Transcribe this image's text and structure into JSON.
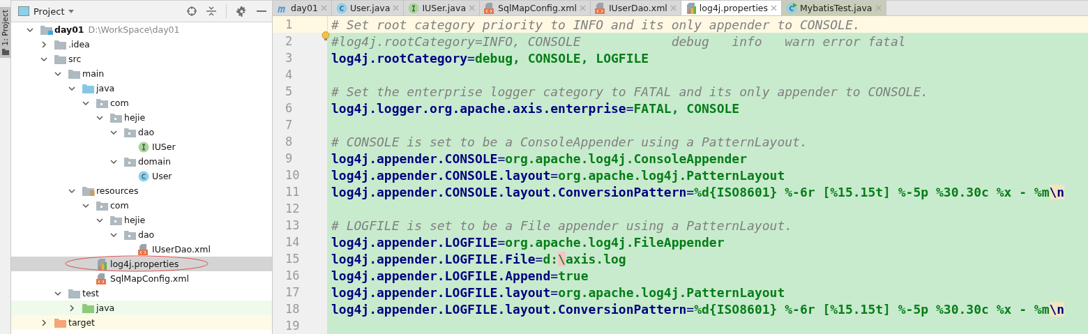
{
  "tool_stripe": {
    "label": "1: Project",
    "selected": true
  },
  "project_panel": {
    "title": "Project",
    "tree": [
      {
        "name": "day01",
        "note": "D:\\WorkSpace\\day01",
        "kind": "module",
        "expanded": true,
        "selected": false,
        "children": [
          {
            "name": ".idea",
            "kind": "folder",
            "expanded": false,
            "selected": false
          },
          {
            "name": "src",
            "kind": "folder",
            "expanded": true,
            "selected": false,
            "children": [
              {
                "name": "main",
                "kind": "folder",
                "expanded": true,
                "selected": false,
                "children": [
                  {
                    "name": "java",
                    "kind": "source-folder",
                    "expanded": true,
                    "selected": false,
                    "children": [
                      {
                        "name": "com",
                        "kind": "package",
                        "expanded": true,
                        "selected": false,
                        "children": [
                          {
                            "name": "hejie",
                            "kind": "package",
                            "expanded": true,
                            "selected": false,
                            "children": [
                              {
                                "name": "dao",
                                "kind": "package",
                                "expanded": true,
                                "selected": false,
                                "children": [
                                  {
                                    "name": "IUSer",
                                    "kind": "interface",
                                    "selected": false
                                  }
                                ]
                              },
                              {
                                "name": "domain",
                                "kind": "package",
                                "expanded": true,
                                "selected": false,
                                "children": [
                                  {
                                    "name": "User",
                                    "kind": "class",
                                    "selected": false
                                  }
                                ]
                              }
                            ]
                          }
                        ]
                      }
                    ]
                  },
                  {
                    "name": "resources",
                    "kind": "resources-folder",
                    "expanded": true,
                    "selected": false,
                    "children": [
                      {
                        "name": "com",
                        "kind": "package",
                        "expanded": true,
                        "selected": false,
                        "children": [
                          {
                            "name": "hejie",
                            "kind": "package",
                            "expanded": true,
                            "selected": false,
                            "children": [
                              {
                                "name": "dao",
                                "kind": "package",
                                "expanded": true,
                                "selected": false,
                                "children": [
                                  {
                                    "name": "IUserDao.xml",
                                    "kind": "xml",
                                    "selected": false
                                  }
                                ]
                              }
                            ]
                          }
                        ]
                      },
                      {
                        "name": "log4j.properties",
                        "kind": "properties",
                        "selected": true,
                        "circled": true
                      },
                      {
                        "name": "SqlMapConfig.xml",
                        "kind": "xml",
                        "selected": false
                      }
                    ]
                  }
                ]
              },
              {
                "name": "test",
                "kind": "folder",
                "expanded": true,
                "selected": false,
                "children": [
                  {
                    "name": "java",
                    "kind": "test-folder",
                    "expanded": false,
                    "selected": false
                  }
                ]
              }
            ]
          },
          {
            "name": "target",
            "kind": "excluded-folder",
            "expanded": false,
            "selected": false
          }
        ]
      }
    ]
  },
  "editor_tabs": [
    {
      "label": "day01",
      "kind": "maven",
      "selected": false
    },
    {
      "label": "User.java",
      "kind": "class",
      "selected": false
    },
    {
      "label": "IUSer.java",
      "kind": "interface",
      "selected": false
    },
    {
      "label": "SqlMapConfig.xml",
      "kind": "xml",
      "selected": false
    },
    {
      "label": "IUserDao.xml",
      "kind": "xml",
      "selected": false
    },
    {
      "label": "log4j.properties",
      "kind": "properties",
      "selected": true
    },
    {
      "label": "MybatisTest.java",
      "kind": "test-class",
      "selected": false
    }
  ],
  "editor_lines": [
    {
      "number": "1",
      "current": true,
      "segments": [
        {
          "kind": "comment",
          "text": "# Set root category priority to INFO and its only appender to CONSOLE."
        }
      ]
    },
    {
      "number": "2",
      "current": false,
      "bulb": true,
      "segments": [
        {
          "kind": "comment",
          "text": "#log4j.rootCategory=INFO, CONSOLE            debug   info   warn error fatal"
        }
      ]
    },
    {
      "number": "3",
      "current": false,
      "segments": [
        {
          "kind": "key",
          "text": "log4j.rootCategory"
        },
        {
          "kind": "sep",
          "text": "="
        },
        {
          "kind": "value",
          "text": "debug, CONSOLE, LOGFILE"
        }
      ]
    },
    {
      "number": "4",
      "current": false
    },
    {
      "number": "5",
      "current": false,
      "segments": [
        {
          "kind": "comment",
          "text": "# Set the enterprise logger category to FATAL and its only appender to CONSOLE."
        }
      ]
    },
    {
      "number": "6",
      "current": false,
      "segments": [
        {
          "kind": "key",
          "text": "log4j.logger.org.apache.axis.enterprise"
        },
        {
          "kind": "sep",
          "text": "="
        },
        {
          "kind": "value",
          "text": "FATAL, CONSOLE"
        }
      ]
    },
    {
      "number": "7",
      "current": false
    },
    {
      "number": "8",
      "current": false,
      "segments": [
        {
          "kind": "comment",
          "text": "# CONSOLE is set to be a ConsoleAppender using a PatternLayout."
        }
      ]
    },
    {
      "number": "9",
      "current": false,
      "segments": [
        {
          "kind": "key",
          "text": "log4j.appender.CONSOLE"
        },
        {
          "kind": "sep",
          "text": "="
        },
        {
          "kind": "value",
          "text": "org.apache.log4j.ConsoleAppender"
        }
      ]
    },
    {
      "number": "10",
      "current": false,
      "segments": [
        {
          "kind": "key",
          "text": "log4j.appender.CONSOLE.layout"
        },
        {
          "kind": "sep",
          "text": "="
        },
        {
          "kind": "value",
          "text": "org.apache.log4j.PatternLayout"
        }
      ]
    },
    {
      "number": "11",
      "current": false,
      "segments": [
        {
          "kind": "key",
          "text": "log4j.appender.CONSOLE.layout.ConversionPattern"
        },
        {
          "kind": "sep",
          "text": "="
        },
        {
          "kind": "value",
          "text": "%d{ISO8601} %-6r [%15.15t] %-5p %30.30c %x - %m"
        },
        {
          "kind": "escape",
          "text": "\\n"
        }
      ]
    },
    {
      "number": "12",
      "current": false
    },
    {
      "number": "13",
      "current": false,
      "segments": [
        {
          "kind": "comment",
          "text": "# LOGFILE is set to be a File appender using a PatternLayout."
        }
      ]
    },
    {
      "number": "14",
      "current": false,
      "segments": [
        {
          "kind": "key",
          "text": "log4j.appender.LOGFILE"
        },
        {
          "kind": "sep",
          "text": "="
        },
        {
          "kind": "value",
          "text": "org.apache.log4j.FileAppender"
        }
      ]
    },
    {
      "number": "15",
      "current": false,
      "segments": [
        {
          "kind": "key",
          "text": "log4j.appender.LOGFILE.File"
        },
        {
          "kind": "sep",
          "text": "="
        },
        {
          "kind": "value",
          "text": "d:"
        },
        {
          "kind": "invalid-escape",
          "text": "\\"
        },
        {
          "kind": "value",
          "text": "axis.log"
        }
      ]
    },
    {
      "number": "16",
      "current": false,
      "segments": [
        {
          "kind": "key",
          "text": "log4j.appender.LOGFILE.Append"
        },
        {
          "kind": "sep",
          "text": "="
        },
        {
          "kind": "value",
          "text": "true"
        }
      ]
    },
    {
      "number": "17",
      "current": false,
      "segments": [
        {
          "kind": "key",
          "text": "log4j.appender.LOGFILE.layout"
        },
        {
          "kind": "sep",
          "text": "="
        },
        {
          "kind": "value",
          "text": "org.apache.log4j.PatternLayout"
        }
      ]
    },
    {
      "number": "18",
      "current": false,
      "segments": [
        {
          "kind": "key",
          "text": "log4j.appender.LOGFILE.layout.ConversionPattern"
        },
        {
          "kind": "sep",
          "text": "="
        },
        {
          "kind": "value",
          "text": "%d{ISO8601} %-6r [%15.15t] %-5p %30.30c %x - %m"
        },
        {
          "kind": "escape",
          "text": "\\n"
        }
      ]
    },
    {
      "number": "19",
      "current": false
    }
  ]
}
